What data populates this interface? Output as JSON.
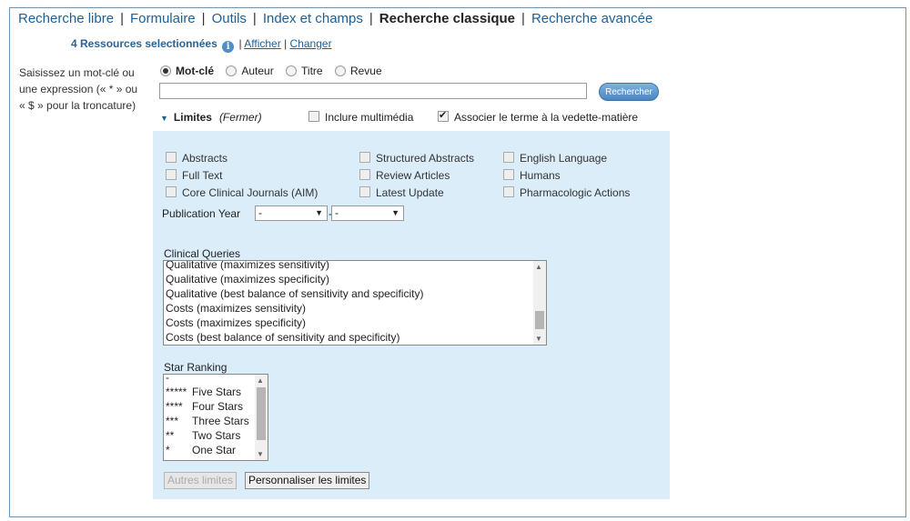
{
  "tabs": [
    {
      "label": "Recherche libre",
      "active": false
    },
    {
      "label": "Formulaire",
      "active": false
    },
    {
      "label": "Outils",
      "active": false
    },
    {
      "label": "Index et champs",
      "active": false
    },
    {
      "label": "Recherche classique",
      "active": true
    },
    {
      "label": "Recherche avancée",
      "active": false
    }
  ],
  "resources": {
    "count_label": "4 Ressources selectionnées",
    "afficher": "Afficher",
    "changer": "Changer",
    "separator": "|"
  },
  "instructions": "Saisissez un mot-clé ou une expression (« * » ou « $ » pour la troncature)",
  "search_mode": {
    "options": [
      "Mot-clé",
      "Auteur",
      "Titre",
      "Revue"
    ],
    "selected": "Mot-clé"
  },
  "search": {
    "value": "",
    "button_label": "Rechercher"
  },
  "limits": {
    "title": "Limites",
    "fermer": "(Fermer)",
    "inclure_multimedia": "Inclure multimédia",
    "associer": "Associer le terme à la vedette-matière",
    "checkboxes": {
      "col1": [
        "Abstracts",
        "Full Text",
        "Core Clinical Journals (AIM)"
      ],
      "col2": [
        "Structured Abstracts",
        "Review Articles",
        "Latest Update"
      ],
      "col3": [
        "English Language",
        "Humans",
        "Pharmacologic Actions"
      ]
    },
    "publication_year": {
      "label": "Publication Year",
      "from": "-",
      "to": "-",
      "dash": "-"
    },
    "clinical_queries": {
      "label": "Clinical Queries",
      "items": [
        "Qualitative (maximizes sensitivity)",
        "Qualitative (maximizes specificity)",
        "Qualitative (best balance of sensitivity and specificity)",
        "Costs (maximizes sensitivity)",
        "Costs (maximizes specificity)",
        "Costs (best balance of sensitivity and specificity)"
      ]
    },
    "star_ranking": {
      "label": "Star Ranking",
      "items": [
        {
          "stars": "-",
          "label": ""
        },
        {
          "stars": "*****",
          "label": "Five Stars"
        },
        {
          "stars": "****",
          "label": "Four Stars"
        },
        {
          "stars": "***",
          "label": "Three Stars"
        },
        {
          "stars": "**",
          "label": "Two Stars"
        },
        {
          "stars": "*",
          "label": "One Star"
        }
      ]
    },
    "autres_limites": "Autres limites",
    "personnaliser": "Personnaliser les limites"
  }
}
